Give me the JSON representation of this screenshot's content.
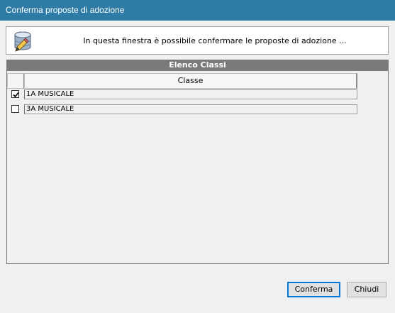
{
  "window": {
    "title": "Conferma proposte di adozione"
  },
  "info": {
    "icon": "database-edit-icon",
    "message": "In questa finestra è possibile confermare le proposte di adozione ..."
  },
  "section": {
    "title": "Elenco Classi"
  },
  "grid": {
    "column_header": "Classe",
    "rows": [
      {
        "label": "1A MUSICALE",
        "checked": true
      },
      {
        "label": "3A MUSICALE",
        "checked": false
      }
    ]
  },
  "buttons": {
    "confirm": "Conferma",
    "close": "Chiudi"
  }
}
